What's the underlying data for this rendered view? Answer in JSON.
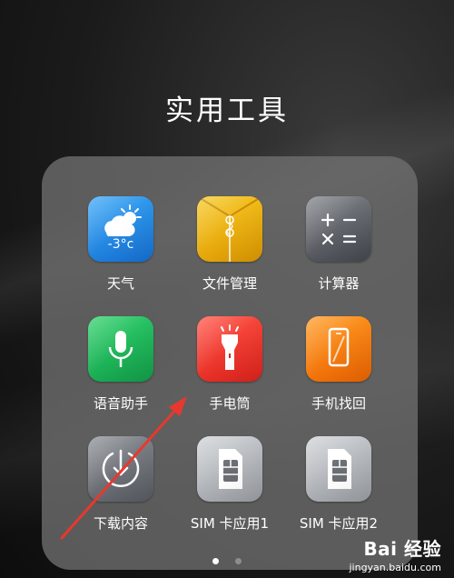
{
  "folder": {
    "title": "实用工具",
    "apps": [
      {
        "label": "天气",
        "icon": "weather-icon",
        "temperature": "-3°c",
        "color": "#2a8ee8"
      },
      {
        "label": "文件管理",
        "icon": "file-manager-icon",
        "color": "#f0b300"
      },
      {
        "label": "计算器",
        "icon": "calculator-icon",
        "color": "#5c6066"
      },
      {
        "label": "语音助手",
        "icon": "microphone-icon",
        "color": "#1fb85a"
      },
      {
        "label": "手电筒",
        "icon": "flashlight-icon",
        "color": "#f53a2e"
      },
      {
        "label": "手机找回",
        "icon": "find-phone-icon",
        "color": "#f57f10"
      },
      {
        "label": "下载内容",
        "icon": "download-icon",
        "color": "#6e7278"
      },
      {
        "label": "SIM 卡应用1",
        "icon": "sim-card-icon",
        "color": "#b8bbbf"
      },
      {
        "label": "SIM 卡应用2",
        "icon": "sim-card-icon",
        "color": "#b8bbbf"
      }
    ]
  },
  "pager": {
    "pages": 2,
    "current": 1
  },
  "watermark": {
    "logo": "Bai 经验",
    "site": "jingyan.baidu.com"
  },
  "annotation": {
    "arrow_color": "#e8382e"
  }
}
